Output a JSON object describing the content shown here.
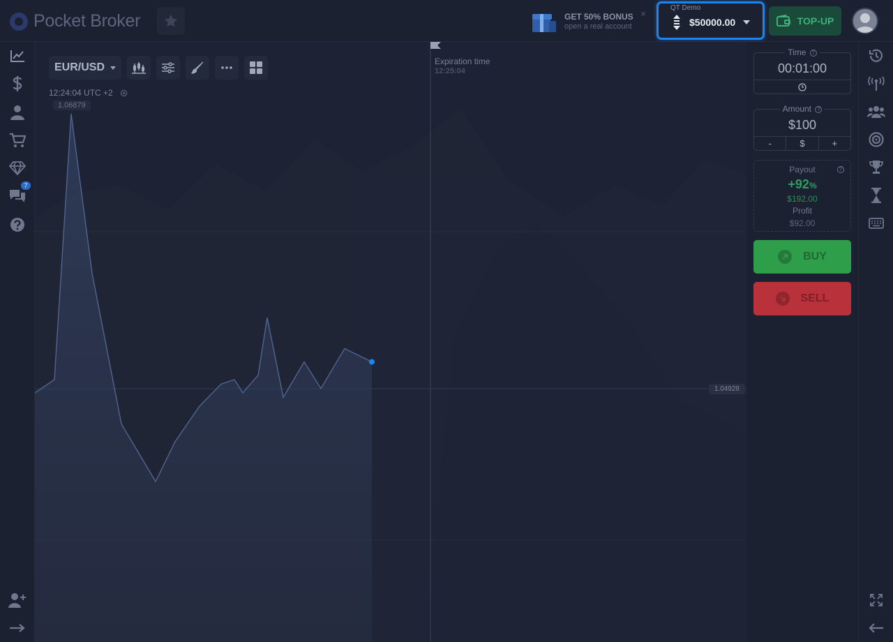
{
  "brand": {
    "name": "Pocket Broker"
  },
  "promo": {
    "title": "GET 50% BONUS",
    "subtitle": "open a real account",
    "close": "×"
  },
  "account": {
    "label": "QT Demo",
    "balance": "$50000.00"
  },
  "topup": {
    "label": "TOP-UP"
  },
  "left_sidebar": {
    "items": [
      "chart-icon",
      "dollar-icon",
      "user-icon",
      "cart-icon",
      "diamond-icon",
      "chat-icon",
      "help-icon",
      "add-user-icon",
      "logout-icon"
    ],
    "chat_badge": "7"
  },
  "chart": {
    "pair": "EUR/USD",
    "time": "12:24:04 UTC +2",
    "max_price": "1.06879",
    "current_price": "1.04928",
    "expiration_label": "Expiration time",
    "expiration_value": "12:25:04"
  },
  "chart_data": {
    "type": "area",
    "y": [
      1.0625,
      1.0628,
      1.0688,
      1.0652,
      1.0618,
      1.0605,
      1.0614,
      1.0622,
      1.0627,
      1.0628,
      1.0625,
      1.0629,
      1.0642,
      1.0624,
      1.0632,
      1.0626,
      1.0635,
      1.0632
    ]
  },
  "trade": {
    "time_label": "Time",
    "time_value": "00:01:00",
    "amount_label": "Amount",
    "amount_value": "$100",
    "minus": "-",
    "currency": "$",
    "plus": "+",
    "payout_label": "Payout",
    "payout_pct": "+92",
    "payout_pct_sign": "%",
    "payout_amount": "$192.00",
    "profit_label": "Profit",
    "profit_amount": "$92.00",
    "buy_label": "BUY",
    "sell_label": "SELL"
  },
  "colors": {
    "accent": "#1a86f5",
    "buy": "#2f9e4a",
    "sell": "#b9313a",
    "background": "#1d2234"
  }
}
